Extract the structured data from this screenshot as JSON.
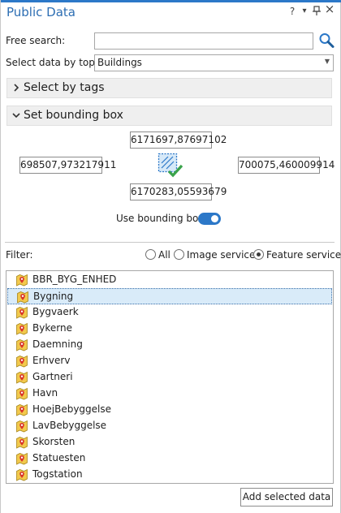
{
  "panel": {
    "title": "Public Data",
    "help_label": "?",
    "menu_label": "▾",
    "pin_label": "⊥",
    "close_label": "×"
  },
  "search": {
    "label": "Free search:",
    "value": "",
    "placeholder": "",
    "icon": "search-icon"
  },
  "topic": {
    "label": "Select data by topic:",
    "selected": "Buildings"
  },
  "sections": {
    "tags": "Select by tags",
    "bbox": "Set bounding box"
  },
  "bbox": {
    "north": "6171697,87697102",
    "west": "698507,973217911",
    "east": "700075,460009914",
    "south": "6170283,05593679",
    "toggle_label": "Use bounding box",
    "toggle_on": true
  },
  "filter": {
    "label": "Filter:",
    "options": [
      {
        "label": "All",
        "checked": false
      },
      {
        "label": "Image services",
        "checked": false
      },
      {
        "label": "Feature services",
        "checked": true
      }
    ]
  },
  "layers": [
    {
      "name": "BBR_BYG_ENHED",
      "selected": false
    },
    {
      "name": "Bygning",
      "selected": true
    },
    {
      "name": "Bygvaerk",
      "selected": false
    },
    {
      "name": "Bykerne",
      "selected": false
    },
    {
      "name": "Daemning",
      "selected": false
    },
    {
      "name": "Erhverv",
      "selected": false
    },
    {
      "name": "Gartneri",
      "selected": false
    },
    {
      "name": "Havn",
      "selected": false
    },
    {
      "name": "HoejBebyggelse",
      "selected": false
    },
    {
      "name": "LavBebyggelse",
      "selected": false
    },
    {
      "name": "Skorsten",
      "selected": false
    },
    {
      "name": "Statuesten",
      "selected": false
    },
    {
      "name": "Togstation",
      "selected": false
    }
  ],
  "actions": {
    "add_label": "Add selected data"
  },
  "colors": {
    "accent": "#2c78c8",
    "title": "#2d6eb3",
    "layer_icon_fill": "#f2c94c",
    "check": "#3aa34a"
  }
}
